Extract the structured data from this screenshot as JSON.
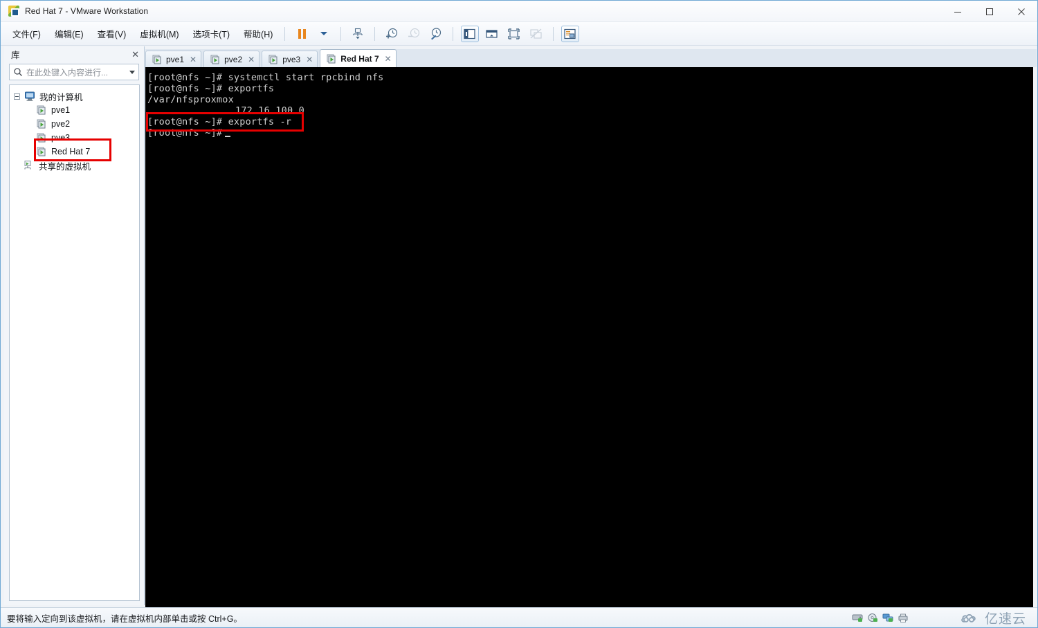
{
  "window": {
    "title": "Red Hat 7 - VMware Workstation",
    "app_icon": "vmware-logo-icon",
    "controls": {
      "minimize": "minimize-icon",
      "maximize": "maximize-icon",
      "close": "close-icon"
    }
  },
  "menubar": {
    "items": [
      {
        "label": "文件(F)",
        "name": "menu-file"
      },
      {
        "label": "编辑(E)",
        "name": "menu-edit"
      },
      {
        "label": "查看(V)",
        "name": "menu-view"
      },
      {
        "label": "虚拟机(M)",
        "name": "menu-vm"
      },
      {
        "label": "选项卡(T)",
        "name": "menu-tabs"
      },
      {
        "label": "帮助(H)",
        "name": "menu-help"
      }
    ]
  },
  "toolbar": {
    "buttons": [
      {
        "name": "suspend-button",
        "icon": "pause-icon",
        "state": "enabled"
      },
      {
        "name": "power-dropdown-button",
        "icon": "chevron-down-icon",
        "state": "enabled"
      },
      {
        "name": "send-ctrl-alt-del-button",
        "icon": "send-keys-icon",
        "state": "enabled"
      },
      {
        "name": "take-snapshot-button",
        "icon": "clock-plus-icon",
        "state": "enabled"
      },
      {
        "name": "revert-snapshot-button",
        "icon": "clock-revert-icon",
        "state": "disabled"
      },
      {
        "name": "snapshot-manager-button",
        "icon": "clock-wrench-icon",
        "state": "enabled"
      },
      {
        "name": "show-library-button",
        "icon": "library-panel-icon",
        "state": "active"
      },
      {
        "name": "console-view-button",
        "icon": "console-view-icon",
        "state": "enabled"
      },
      {
        "name": "fullscreen-button",
        "icon": "fullscreen-icon",
        "state": "enabled"
      },
      {
        "name": "unity-mode-button",
        "icon": "unity-mode-icon",
        "state": "disabled"
      },
      {
        "name": "preferences-button",
        "icon": "preferences-icon",
        "state": "active"
      }
    ]
  },
  "library": {
    "title": "库",
    "close_label": "✕",
    "search": {
      "placeholder": "在此处键入内容进行...",
      "value": "",
      "icon": "search-icon",
      "dropdown_icon": "chevron-down-icon"
    },
    "tree": {
      "root": {
        "label": "我的计算机",
        "icon": "my-computer-icon",
        "expanded": true
      },
      "vms": [
        {
          "label": "pve1",
          "icon": "virtual-machine-icon"
        },
        {
          "label": "pve2",
          "icon": "virtual-machine-icon"
        },
        {
          "label": "pve3",
          "icon": "virtual-machine-icon"
        },
        {
          "label": "Red Hat 7",
          "icon": "virtual-machine-icon",
          "highlighted": true
        }
      ],
      "shared": {
        "label": "共享的虚拟机",
        "icon": "shared-vms-icon"
      }
    }
  },
  "tabs": [
    {
      "label": "pve1",
      "icon": "virtual-machine-icon",
      "active": false,
      "close_label": "✕"
    },
    {
      "label": "pve2",
      "icon": "virtual-machine-icon",
      "active": false,
      "close_label": "✕"
    },
    {
      "label": "pve3",
      "icon": "virtual-machine-icon",
      "active": false,
      "close_label": "✕"
    },
    {
      "label": "Red Hat 7",
      "icon": "virtual-machine-icon",
      "active": true,
      "close_label": "✕"
    }
  ],
  "terminal": {
    "background": "#000000",
    "foreground": "#cfcfcf",
    "lines": [
      {
        "text": "[root@nfs ~]# systemctl start rpcbind nfs",
        "indent": false
      },
      {
        "text": "[root@nfs ~]# exportfs",
        "indent": false
      },
      {
        "text": "/var/nfsproxmox",
        "indent": false
      },
      {
        "text": "172.16.100.0",
        "indent": true
      },
      {
        "text": "[root@nfs ~]# exportfs -r",
        "indent": false
      },
      {
        "text": "[root@nfs ~]#",
        "indent": false,
        "cursor": true
      }
    ]
  },
  "annotations": {
    "color": "#e60000",
    "boxes": [
      {
        "name": "annotation-box-library-redhat7",
        "target": "Red Hat 7"
      },
      {
        "name": "annotation-box-terminal-exportfs-r",
        "target": "[root@nfs ~]# exportfs -r"
      }
    ]
  },
  "statusbar": {
    "message": "要将输入定向到该虚拟机，请在虚拟机内部单击或按 Ctrl+G。",
    "devices": [
      {
        "name": "hard-disk-icon"
      },
      {
        "name": "cd-dvd-icon"
      },
      {
        "name": "network-adapter-icon"
      },
      {
        "name": "printer-icon"
      }
    ],
    "watermark": {
      "text": "亿速云",
      "icon": "cloud-icon",
      "color": "#8fa3b5"
    }
  }
}
